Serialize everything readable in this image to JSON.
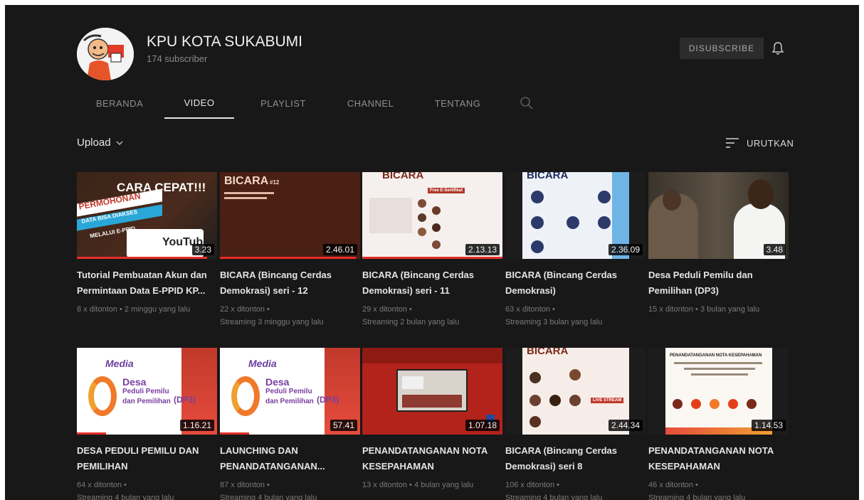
{
  "channel": {
    "name": "KPU KOTA SUKABUMI",
    "subscribers": "174 subscriber",
    "subscribe_button": "DISUBSCRIBE"
  },
  "tabs": [
    {
      "label": "BERANDA",
      "active": false
    },
    {
      "label": "VIDEO",
      "active": true
    },
    {
      "label": "PLAYLIST",
      "active": false
    },
    {
      "label": "CHANNEL",
      "active": false
    },
    {
      "label": "TENTANG",
      "active": false
    }
  ],
  "toolbar": {
    "upload_label": "Upload",
    "sort_label": "URUTKAN"
  },
  "thumb_text": {
    "v1_big": "CARA CEPAT!!!",
    "v1_banner": "PERMOHONAN",
    "v1_sub": "DATA BISA DIAKSES",
    "v1_sub2": "MELALUI E-PPID",
    "v1_logo": "YouTube",
    "bicara": "BICARA",
    "bicara_12": "#12",
    "meda": "Media",
    "desa": "Desa",
    "peduli": "Peduli Pemilu",
    "pemilihan": "dan Pemilihan",
    "dp3": "(DP3)",
    "nota_title": "PENANDATANGANAN NOTA KESEPAHAMAN",
    "ekrit": "Free E-Sertifikat",
    "live": "LIVE STREAM"
  },
  "videos": [
    {
      "title": "Tutorial Pembuatan Akun dan Permintaan Data E-PPID KP...",
      "duration": "3.23",
      "meta1": "8 x ditonton • 2 minggu yang lalu",
      "meta2": "",
      "progress": 0.93
    },
    {
      "title": "BICARA (Bincang Cerdas Demokrasi) seri - 12",
      "duration": "2.46.01",
      "meta1": "22 x ditonton •",
      "meta2": "Streaming 3 minggu yang lalu",
      "progress": 0.97
    },
    {
      "title": "BICARA (Bincang Cerdas Demokrasi) seri - 11",
      "duration": "2.13.13",
      "meta1": "29 x ditonton •",
      "meta2": "Streaming 2 bulan yang lalu",
      "progress": 1.0
    },
    {
      "title": "BICARA (Bincang Cerdas Demokrasi)",
      "duration": "2.36.09",
      "meta1": "63 x ditonton •",
      "meta2": "Streaming 3 bulan yang lalu",
      "progress": 0.0
    },
    {
      "title": "Desa Peduli Pemilu dan Pemilihan (DP3)",
      "duration": "3.48",
      "meta1": "15 x ditonton • 3 bulan yang lalu",
      "meta2": "",
      "progress": 0.0
    },
    {
      "title": "DESA PEDULI PEMILU DAN PEMILIHAN",
      "duration": "1.16.21",
      "meta1": "64 x ditonton •",
      "meta2": "Streaming 4 bulan yang lalu",
      "progress": 0.21
    },
    {
      "title": "LAUNCHING DAN PENANDATANGANAN...",
      "duration": "57.41",
      "meta1": "87 x ditonton •",
      "meta2": "Streaming 4 bulan yang lalu",
      "progress": 0.21
    },
    {
      "title": "PENANDATANGANAN NOTA KESEPAHAMAN",
      "duration": "1.07.18",
      "meta1": "13 x ditonton • 4 bulan yang lalu",
      "meta2": "",
      "progress": 0.0
    },
    {
      "title": "BICARA (Bincang Cerdas Demokrasi) seri 8",
      "duration": "2.44.34",
      "meta1": "106 x ditonton •",
      "meta2": "Streaming 4 bulan yang lalu",
      "progress": 0.0
    },
    {
      "title": "PENANDATANGANAN NOTA KESEPAHAMAN",
      "duration": "1.14.53",
      "meta1": "46 x ditonton •",
      "meta2": "Streaming 4 bulan yang lalu",
      "progress": 0.0
    }
  ]
}
